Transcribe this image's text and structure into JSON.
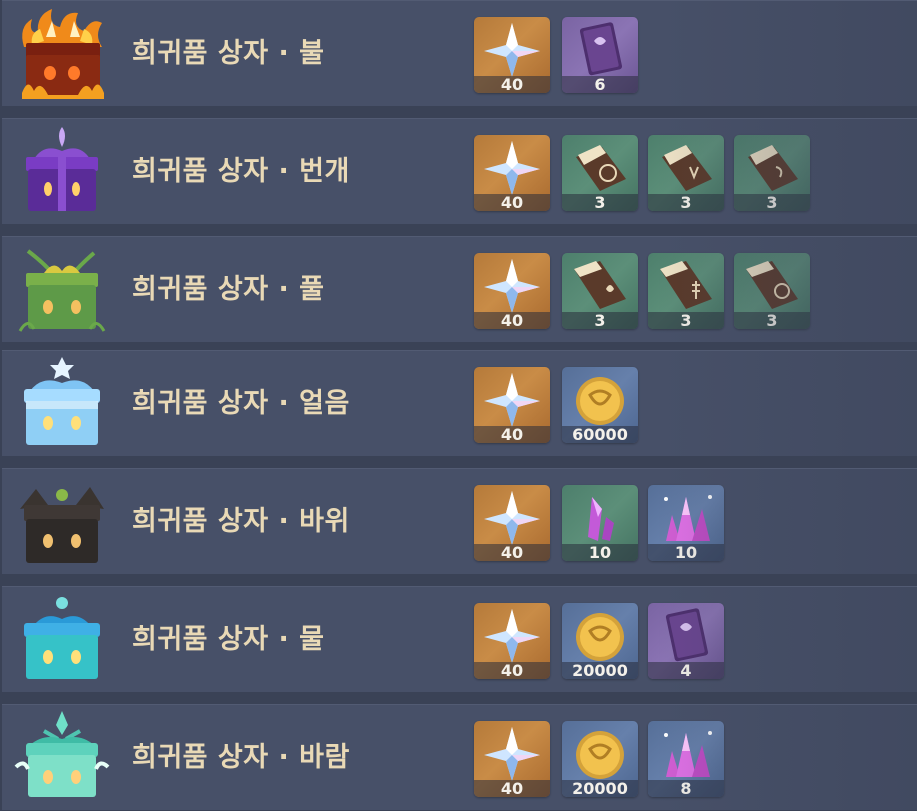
{
  "chests": [
    {
      "title": "희귀품 상자 · 불",
      "chest_icon": "pyro-chest-icon",
      "rewards": [
        {
          "icon": "primogem-icon",
          "qty": "40"
        },
        {
          "icon": "purple-book-icon",
          "qty": "6"
        }
      ]
    },
    {
      "title": "희귀품 상자 · 번개",
      "chest_icon": "electro-chest-icon",
      "rewards": [
        {
          "icon": "primogem-icon",
          "qty": "40"
        },
        {
          "icon": "talent-book-icon",
          "qty": "3"
        },
        {
          "icon": "talent-book-icon",
          "qty": "3"
        },
        {
          "icon": "talent-book-icon",
          "qty": "3"
        }
      ]
    },
    {
      "title": "희귀품 상자 · 풀",
      "chest_icon": "dendro-chest-icon",
      "rewards": [
        {
          "icon": "primogem-icon",
          "qty": "40"
        },
        {
          "icon": "talent-book-icon",
          "qty": "3"
        },
        {
          "icon": "talent-book-icon",
          "qty": "3"
        },
        {
          "icon": "talent-book-icon",
          "qty": "3"
        }
      ]
    },
    {
      "title": "희귀품 상자 · 얼음",
      "chest_icon": "cryo-chest-icon",
      "rewards": [
        {
          "icon": "primogem-icon",
          "qty": "40"
        },
        {
          "icon": "mora-coin-icon",
          "qty": "60000"
        }
      ]
    },
    {
      "title": "희귀품 상자 · 바위",
      "chest_icon": "geo-chest-icon",
      "rewards": [
        {
          "icon": "primogem-icon",
          "qty": "40"
        },
        {
          "icon": "purple-crystal-icon",
          "qty": "10"
        },
        {
          "icon": "crystal-cluster-icon",
          "qty": "10"
        }
      ]
    },
    {
      "title": "희귀품 상자 · 물",
      "chest_icon": "hydro-chest-icon",
      "rewards": [
        {
          "icon": "primogem-icon",
          "qty": "40"
        },
        {
          "icon": "mora-coin-icon",
          "qty": "20000"
        },
        {
          "icon": "purple-book-icon",
          "qty": "4"
        }
      ]
    },
    {
      "title": "희귀품 상자 · 바람",
      "chest_icon": "anemo-chest-icon",
      "rewards": [
        {
          "icon": "primogem-icon",
          "qty": "40"
        },
        {
          "icon": "mora-coin-icon",
          "qty": "20000"
        },
        {
          "icon": "crystal-cluster-icon",
          "qty": "8"
        }
      ]
    }
  ]
}
